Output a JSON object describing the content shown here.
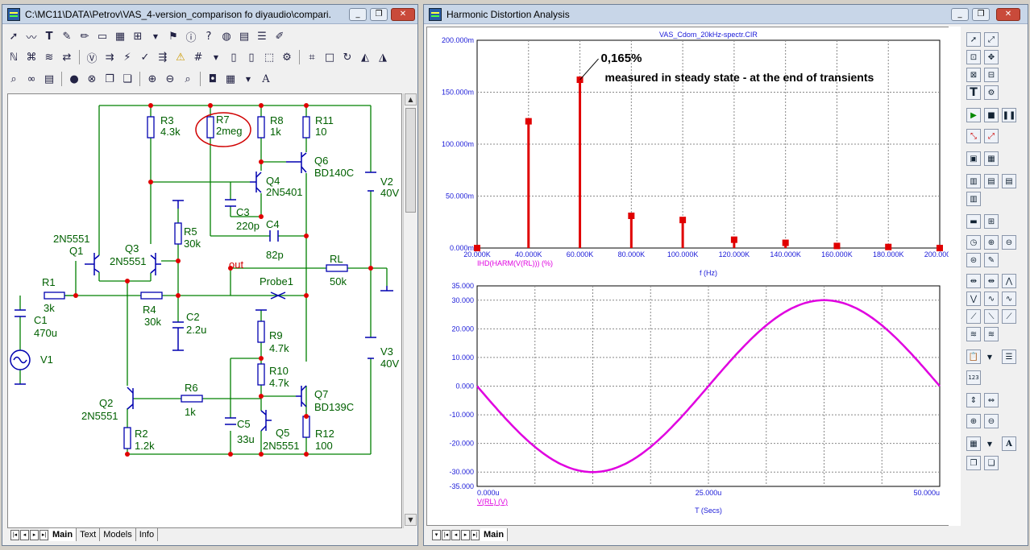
{
  "schematic_window": {
    "title": "C:\\MC11\\DATA\\Petrov\\VAS_4-version_comparison fo diyaudio\\compari...",
    "tabs": [
      "Main",
      "Text",
      "Models",
      "Info"
    ],
    "active_tab": "Main"
  },
  "schematic": {
    "labels": {
      "R3": "R3",
      "R3v": "4.3k",
      "R7": "R7",
      "R7v": "2meg",
      "R8": "R8",
      "R8v": "1k",
      "R11": "R11",
      "R11v": "10",
      "Q6": "Q6",
      "Q6v": "BD140C",
      "Q4": "Q4",
      "Q4v": "2N5401",
      "V2": "V2",
      "V2v": "40V",
      "C3": "C3",
      "C3v": "220p",
      "C4": "C4",
      "C4v": "82p",
      "R5": "R5",
      "R5v": "30k",
      "Q1v": "2N5551",
      "Q1": "Q1",
      "Q3": "Q3",
      "Q3v": "2N5551",
      "out": "out",
      "RL": "RL",
      "RLv": "50k",
      "R1": "R1",
      "R1v": "3k",
      "Probe1": "Probe1",
      "R4": "R4",
      "R4v": "30k",
      "C2": "C2",
      "C2v": "2.2u",
      "C1": "C1",
      "C1v": "470u",
      "V1": "V1",
      "R9": "R9",
      "R9v": "4.7k",
      "V3": "V3",
      "V3v": "40V",
      "R10": "R10",
      "R10v": "4.7k",
      "R6": "R6",
      "R6v": "1k",
      "Q7": "Q7",
      "Q7v": "BD139C",
      "Q2": "Q2",
      "Q2v": "2N5551",
      "C5": "C5",
      "C5v": "33u",
      "Q5": "Q5",
      "Q5v": "2N5551",
      "R2": "R2",
      "R2v": "1.2k",
      "R12": "R12",
      "R12v": "100"
    }
  },
  "analysis_window": {
    "title": "Harmonic Distortion Analysis",
    "tabs": [
      "Main"
    ],
    "active_tab": "Main"
  },
  "plot_title": "VAS_Cdom_20kHz-spectr.CIR",
  "annotation": {
    "value": "0,165%",
    "note": "measured in steady state - at the end of transients"
  },
  "chart_data": [
    {
      "type": "bar",
      "xlabel": "f (Hz)",
      "ylabel": "IHD(HARM(V(RL))) (%)",
      "xlim": [
        20000,
        200000
      ],
      "ylim": [
        0,
        0.2
      ],
      "x_ticks": [
        "20.000K",
        "40.000K",
        "60.000K",
        "80.000K",
        "100.000K",
        "120.000K",
        "140.000K",
        "160.000K",
        "180.000K",
        "200.000K"
      ],
      "y_ticks": [
        "0.000m",
        "50.000m",
        "100.000m",
        "150.000m",
        "200.000m"
      ],
      "x": [
        20000,
        40000,
        60000,
        80000,
        100000,
        120000,
        140000,
        160000,
        180000,
        200000
      ],
      "values": [
        0,
        0.122,
        0.162,
        0.031,
        0.027,
        0.008,
        0.005,
        0.002,
        0.001,
        0
      ],
      "color": "#e00000",
      "grid": true
    },
    {
      "type": "line",
      "xlabel": "T (Secs)",
      "ylabel": "V(RL) (V)",
      "xlim": [
        0,
        50
      ],
      "ylim": [
        -35,
        35
      ],
      "x_ticks": [
        "0.000u",
        "25.000u",
        "50.000u"
      ],
      "y_ticks": [
        "35.000",
        "30.000",
        "20.000",
        "10.000",
        "0.000",
        "-10.000",
        "-20.000",
        "-30.000",
        "-35.000"
      ],
      "x_unit": "us",
      "amplitude": 30,
      "frequency_khz": 20,
      "phase_deg": 180,
      "color": "#e000e0",
      "grid": true
    }
  ],
  "colors": {
    "schematic_wire": "#008000",
    "schematic_component": "#0000b0",
    "node_dot": "#e00000",
    "label": "#006000",
    "highlight_circle": "#d00000"
  }
}
